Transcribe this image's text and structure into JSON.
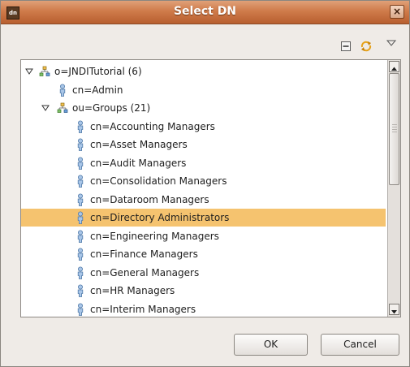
{
  "window": {
    "title": "Select DN",
    "app_icon_text": "dn",
    "close_glyph": "×"
  },
  "toolbar": {
    "icons": [
      {
        "name": "collapse-all-icon"
      },
      {
        "name": "refresh-icon"
      },
      {
        "name": "view-menu-chevron-icon"
      }
    ]
  },
  "tree": {
    "rows": [
      {
        "label": "o=JNDITutorial (6)",
        "kind": "org",
        "level": 0,
        "expanded": true
      },
      {
        "label": "cn=Admin",
        "kind": "person",
        "level": 1
      },
      {
        "label": "ou=Groups (21)",
        "kind": "org",
        "level": 1,
        "expanded": true
      },
      {
        "label": "cn=Accounting Managers",
        "kind": "person",
        "level": 2
      },
      {
        "label": "cn=Asset Managers",
        "kind": "person",
        "level": 2
      },
      {
        "label": "cn=Audit Managers",
        "kind": "person",
        "level": 2
      },
      {
        "label": "cn=Consolidation Managers",
        "kind": "person",
        "level": 2
      },
      {
        "label": "cn=Dataroom Managers",
        "kind": "person",
        "level": 2
      },
      {
        "label": "cn=Directory Administrators",
        "kind": "person",
        "level": 2,
        "selected": true
      },
      {
        "label": "cn=Engineering Managers",
        "kind": "person",
        "level": 2
      },
      {
        "label": "cn=Finance Managers",
        "kind": "person",
        "level": 2
      },
      {
        "label": "cn=General Managers",
        "kind": "person",
        "level": 2
      },
      {
        "label": "cn=HR Managers",
        "kind": "person",
        "level": 2
      },
      {
        "label": "cn=Interim Managers",
        "kind": "person",
        "level": 2
      }
    ]
  },
  "buttons": {
    "ok": "OK",
    "cancel": "Cancel"
  },
  "colors": {
    "titlebar": "#cf7b4a",
    "selection": "#f5c36f",
    "dialog_bg": "#efebe7"
  }
}
